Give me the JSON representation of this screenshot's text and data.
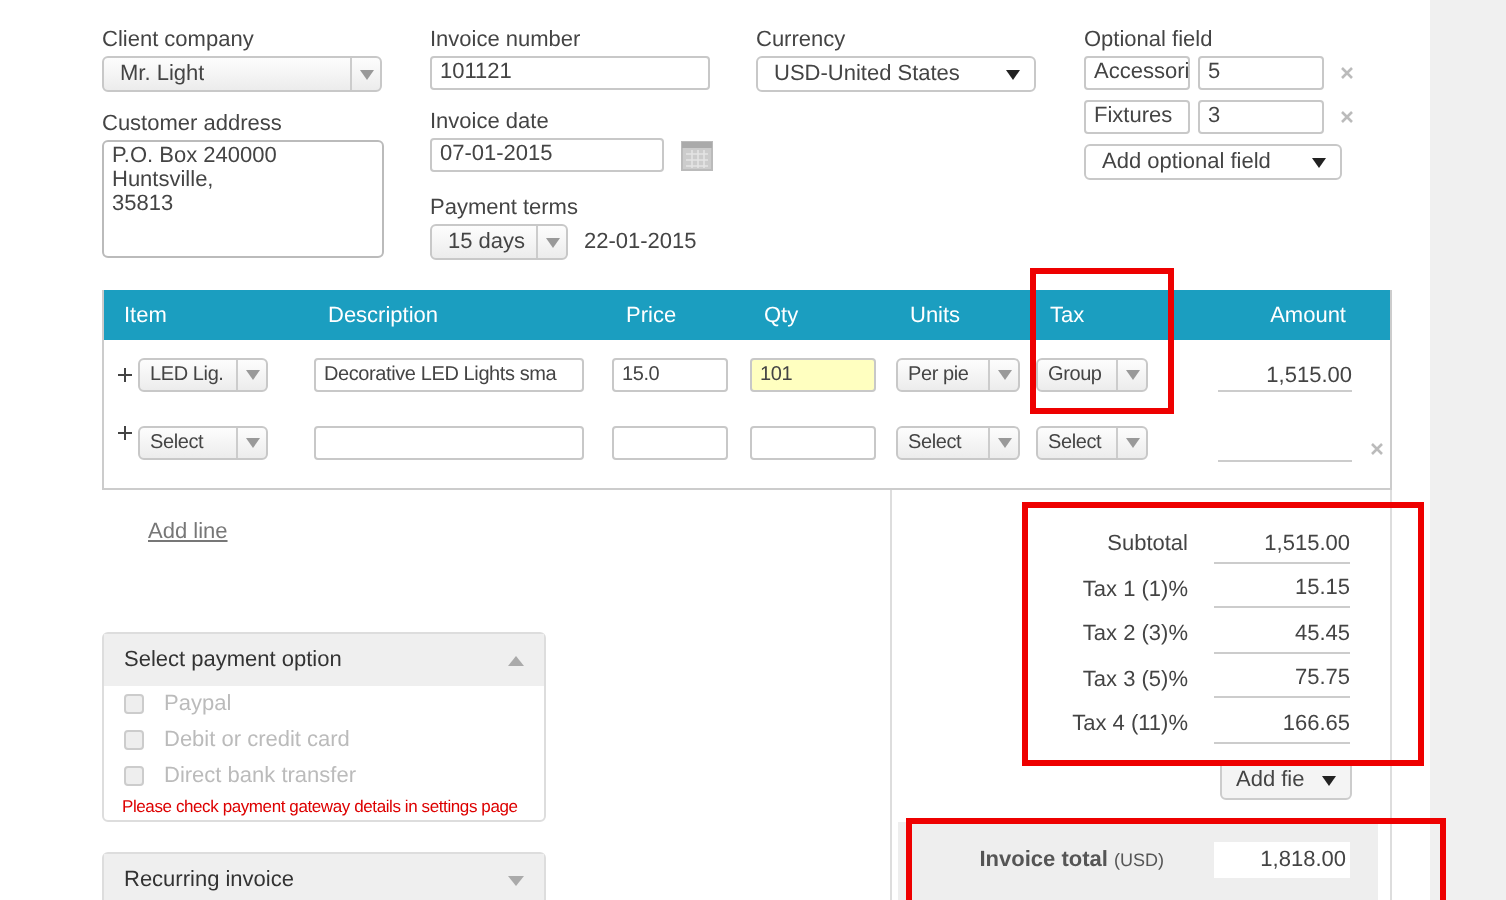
{
  "client_company": {
    "label": "Client company",
    "value": "Mr. Light"
  },
  "customer_address": {
    "label": "Customer address",
    "value": "P.O. Box 240000\nHuntsville,\n35813"
  },
  "invoice_number": {
    "label": "Invoice number",
    "value": "101121"
  },
  "invoice_date": {
    "label": "Invoice date",
    "value": "07-01-2015"
  },
  "payment_terms": {
    "label": "Payment terms",
    "value": "15 days",
    "due_date": "22-01-2015"
  },
  "currency": {
    "label": "Currency",
    "value": "USD-United States"
  },
  "optional_fields": {
    "label": "Optional field",
    "fields": [
      {
        "name": "Accessori",
        "value": "5"
      },
      {
        "name": "Fixtures",
        "value": "3"
      }
    ],
    "add_label": "Add optional field"
  },
  "table": {
    "columns": [
      "Item",
      "Description",
      "Price",
      "Qty",
      "Units",
      "Tax",
      "Amount"
    ],
    "rows": [
      {
        "item": "LED Lig.",
        "description": "Decorative LED Lights sma",
        "price": "15.0",
        "qty": "101",
        "highlighted": true,
        "units": "Per pie",
        "tax": "Group",
        "amount": "1,515.00",
        "removable": false
      },
      {
        "item": "Select",
        "units": "Select",
        "tax": "Select",
        "highlighted": false,
        "removable": true
      }
    ]
  },
  "add_line": "Add line",
  "totals": {
    "rows": [
      {
        "label": "Subtotal",
        "value": "1,515.00"
      },
      {
        "label": "Tax 1 (1)%",
        "value": "15.15"
      },
      {
        "label": "Tax 2 (3)%",
        "value": "45.45"
      },
      {
        "label": "Tax 3 (5)%",
        "value": "75.75"
      },
      {
        "label": "Tax 4 (11)%",
        "value": "166.65"
      }
    ],
    "add_field": "Add fie",
    "total": {
      "label": "Invoice total",
      "currency": "(USD)",
      "value": "1,818.00"
    }
  },
  "payment": {
    "title": "Select payment option",
    "expanded": true,
    "options": [
      {
        "label": "Paypal",
        "checked": false,
        "disabled": true
      },
      {
        "label": "Debit or credit card",
        "checked": false,
        "disabled": true
      },
      {
        "label": "Direct bank transfer",
        "checked": false,
        "disabled": true
      }
    ],
    "warning": "Please check payment gateway details in settings page"
  },
  "recurring": {
    "title": "Recurring invoice",
    "expanded": false
  }
}
